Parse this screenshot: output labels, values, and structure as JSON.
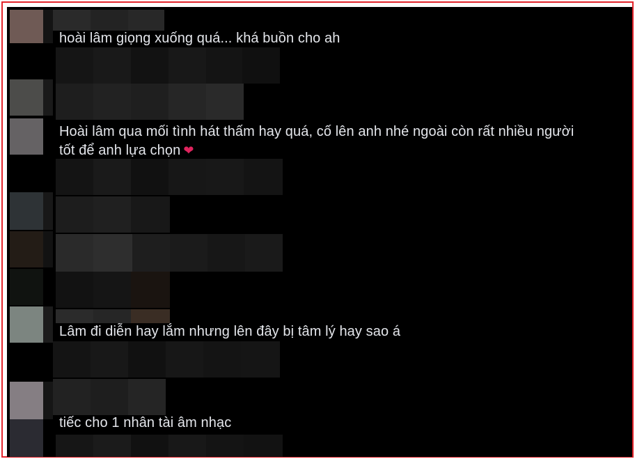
{
  "comments": [
    {
      "text": "hoài lâm giọng xuống quá... khá buồn cho ah"
    },
    {
      "text": "Hoài lâm qua mối tình hát thấm hay quá, cố lên anh nhé ngoài còn rất nhiều người",
      "text_line2": "tốt để anh lựa chọn",
      "emoji": "heart"
    },
    {
      "text": "Lâm đi diễn hay lắm nhưng lên đây bị tâm lý hay sao á"
    },
    {
      "text": "tiếc cho 1 nhân tài âm nhạc"
    }
  ],
  "colors": {
    "frame_border": "#e3242b",
    "background": "#000000",
    "comment_text": "#e4e6eb",
    "heart": "#e0245e"
  }
}
